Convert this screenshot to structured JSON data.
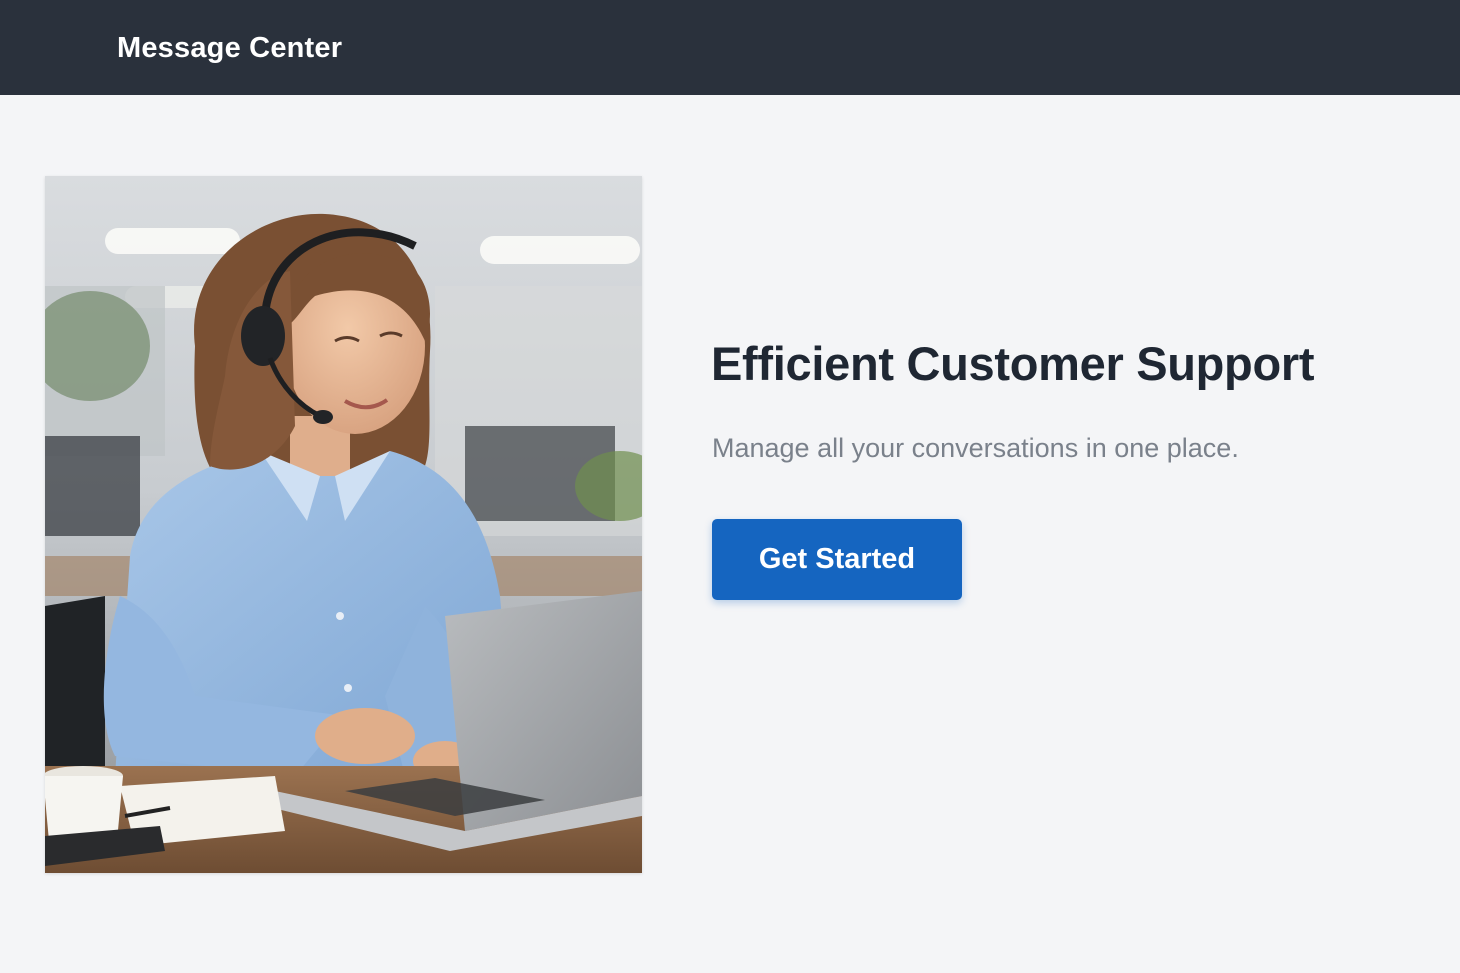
{
  "header": {
    "title": "Message Center",
    "background": "#2a313c"
  },
  "hero": {
    "image_icon": "customer-support-agent-photo",
    "heading": "Efficient Customer Support",
    "subheading": "Manage all your conversations in one place.",
    "cta_label": "Get Started",
    "cta_color": "#1565c0"
  },
  "page": {
    "background": "#f4f5f7"
  }
}
